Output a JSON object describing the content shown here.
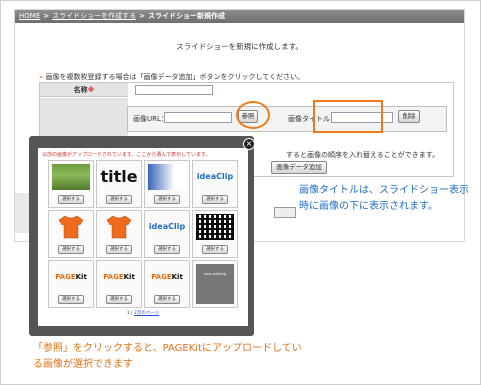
{
  "breadcrumb": {
    "home": "HOME",
    "create": "スライドショーを作成する",
    "current": "スライドショー新規作成"
  },
  "page": {
    "lead": "スライドショーを新規に作成します。",
    "instruction": "画像を複数枚登録する場合は「画像データ追加」ボタンをクリックしてください。",
    "name_label": "名称",
    "required_mark": "※",
    "url_label": "画像URL：",
    "browse_label": "参照",
    "title_label": "画像タイトル：",
    "delete_label": "削除",
    "order_note": "すると画像の順序を入れ替えることができます。",
    "add_label": "画像データ追加"
  },
  "modal": {
    "title": "以前の画像がアップロードされています。ここから選んで表示しています。",
    "select_label": "選択する",
    "items": [
      {
        "type": "photo"
      },
      {
        "type": "title",
        "text": "title"
      },
      {
        "type": "banner"
      },
      {
        "type": "ideaclip",
        "text": "ideaClip"
      },
      {
        "type": "shirt"
      },
      {
        "type": "shirt"
      },
      {
        "type": "ideaclip",
        "text": "ideaClip"
      },
      {
        "type": "qr"
      },
      {
        "type": "pagekit",
        "text": "PAGEKit"
      },
      {
        "type": "pagekit",
        "text": "PAGEKit"
      },
      {
        "type": "pagekit",
        "text": "PAGEKit"
      },
      {
        "type": "now",
        "text": "now printing"
      }
    ],
    "pager_current": "1",
    "pager_sep": "|",
    "pager_link": "2",
    "pager_next": "次のページ"
  },
  "annotations": {
    "right": "画像タイトルは、スライドショー表示時に画像の下に表示されます。",
    "bottom": "「参照」をクリックすると、PAGEKitにアップロードしている画像が選択できます"
  },
  "colors": {
    "highlight": "#f07a1a",
    "note_blue": "#1f6ec4",
    "note_orange": "#e07318",
    "shirt": "#ee6a1c"
  }
}
